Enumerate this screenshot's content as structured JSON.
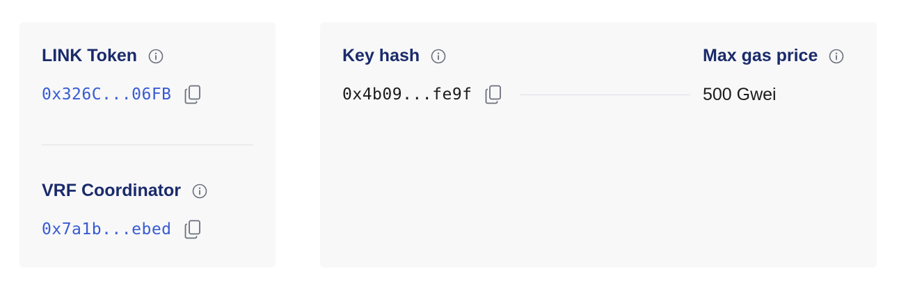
{
  "link_token": {
    "label": "LINK Token",
    "address": "0x326C...06FB"
  },
  "vrf_coordinator": {
    "label": "VRF Coordinator",
    "address": "0x7a1b...ebed"
  },
  "key_hash": {
    "label": "Key hash",
    "value": "0x4b09...fe9f"
  },
  "max_gas_price": {
    "label": "Max gas price",
    "value": "500 Gwei"
  },
  "colors": {
    "heading": "#1a2b6b",
    "link": "#375bd2",
    "card_bg": "#f8f8f9",
    "icon": "#6b6f7b"
  },
  "icons": [
    "info-icon",
    "copy-icon"
  ]
}
